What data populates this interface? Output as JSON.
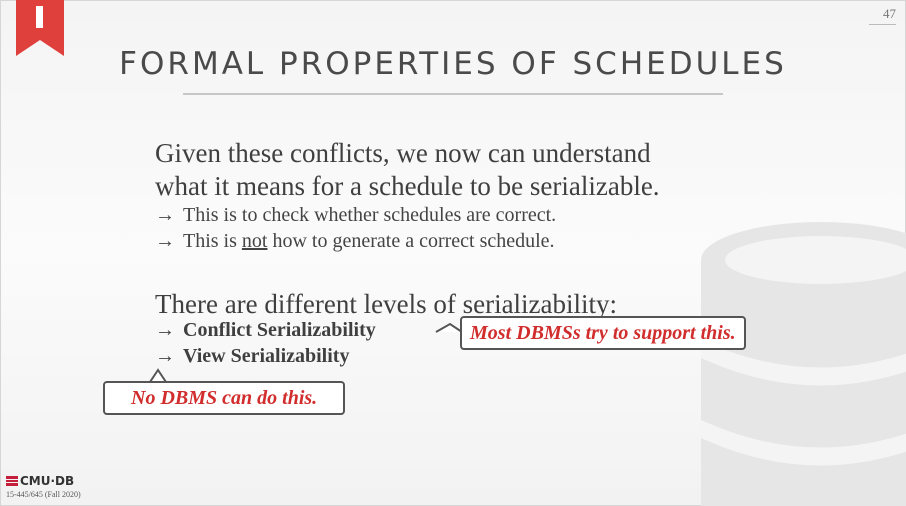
{
  "slide": {
    "page_number": "47",
    "title": "FORMAL PROPERTIES OF SCHEDULES",
    "lead1_line1": "Given these conflicts, we now can understand",
    "lead1_line2": "what it means for a schedule to be serializable.",
    "arrow": "→",
    "bullet1": "This is to check whether schedules are correct.",
    "bullet2_pre": "This is ",
    "bullet2_not": "not",
    "bullet2_post": " how to generate a correct schedule.",
    "lead2": "There are different levels of serializability:",
    "bold1": "Conflict Serializability",
    "bold2": "View Serializability",
    "callout1": "Most DBMSs try to support this.",
    "callout2": "No DBMS can do this."
  },
  "footer": {
    "logo_text": "CMU·DB",
    "course": "15-445/645 (Fall 2020)"
  },
  "colors": {
    "accent_red": "#e0403c",
    "callout_text": "#d12d2d"
  },
  "icons": [
    "bookmark-icon",
    "database-icon",
    "cmu-db-logo-icon"
  ]
}
